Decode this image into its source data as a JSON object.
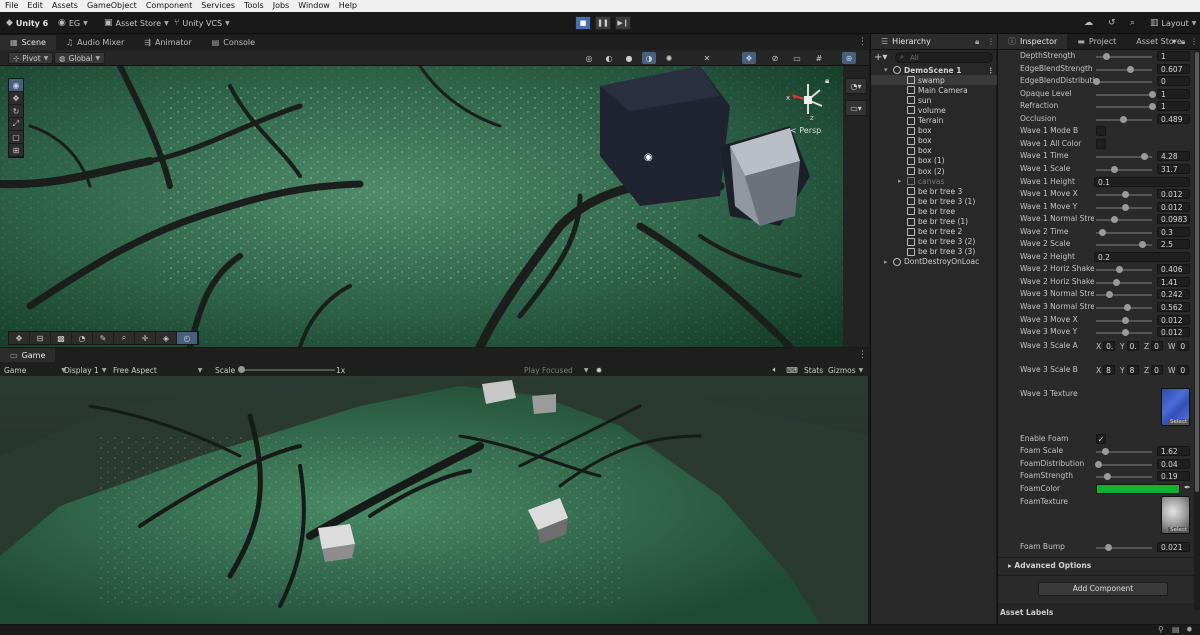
{
  "menubar": {
    "items": [
      "File",
      "Edit",
      "Assets",
      "GameObject",
      "Component",
      "Services",
      "Tools",
      "Jobs",
      "Window",
      "Help"
    ]
  },
  "toolbar": {
    "unity_label": "Unity 6",
    "account_label": "EG",
    "asset_store_label": "Asset Store",
    "vcs_label": "Unity VCS",
    "layout_label": "Layout"
  },
  "scene_tabs": [
    "Scene",
    "Audio Mixer",
    "Animator",
    "Console"
  ],
  "scene_toolbar": {
    "pivot": "Pivot",
    "global": "Global"
  },
  "scene_view": {
    "persp_label": "< Persp",
    "gizmo_x": "x",
    "gizmo_z": "z"
  },
  "game_tab": {
    "label": "Game"
  },
  "game_toolbar": {
    "display_mode": "Game",
    "display": "Display 1",
    "aspect": "Free Aspect",
    "scale_label": "Scale",
    "scale_value": "1x",
    "play_focused": "Play Focused",
    "stats": "Stats",
    "gizmos": "Gizmos"
  },
  "hierarchy": {
    "title": "Hierarchy",
    "search_placeholder": "All",
    "items": [
      {
        "label": "DemoScene 1",
        "style": "bold"
      },
      {
        "label": "swamp",
        "style": "sel"
      },
      {
        "label": "Main Camera",
        "style": ""
      },
      {
        "label": "sun",
        "style": ""
      },
      {
        "label": "volume",
        "style": ""
      },
      {
        "label": "Terrain",
        "style": ""
      },
      {
        "label": "box",
        "style": ""
      },
      {
        "label": "box",
        "style": ""
      },
      {
        "label": "box",
        "style": ""
      },
      {
        "label": "box (1)",
        "style": ""
      },
      {
        "label": "box (2)",
        "style": ""
      },
      {
        "label": "canvas",
        "style": "dim"
      },
      {
        "label": "be br tree 3",
        "style": ""
      },
      {
        "label": "be br tree 3 (1)",
        "style": ""
      },
      {
        "label": "be br tree",
        "style": ""
      },
      {
        "label": "be br tree (1)",
        "style": ""
      },
      {
        "label": "be br tree 2",
        "style": ""
      },
      {
        "label": "be br tree 3 (2)",
        "style": ""
      },
      {
        "label": "be br tree 3 (3)",
        "style": ""
      },
      {
        "label": "DontDestroyOnLoac",
        "style": "root"
      }
    ]
  },
  "inspector": {
    "tabs": [
      "Inspector",
      "Project",
      "Asset Store"
    ],
    "properties": [
      {
        "label": "DepthStrength",
        "kind": "slider",
        "value": "1",
        "pos": 0.18
      },
      {
        "label": "EdgeBlendStrength",
        "kind": "slider",
        "value": "0.607",
        "pos": 0.6
      },
      {
        "label": "EdgeBlendDistributio",
        "kind": "slider",
        "value": "0",
        "pos": 0.0
      },
      {
        "label": "Opaque Level",
        "kind": "slider",
        "value": "1",
        "pos": 1.0
      },
      {
        "label": "Refraction",
        "kind": "slider",
        "value": "1",
        "pos": 1.0
      },
      {
        "label": "Occlusion",
        "kind": "slider",
        "value": "0.489",
        "pos": 0.49
      },
      {
        "label": "Wave 1 Mode B",
        "kind": "check",
        "value": ""
      },
      {
        "label": "Wave 1 All Color",
        "kind": "check",
        "value": ""
      },
      {
        "label": "Wave 1 Time",
        "kind": "slider",
        "value": "4.28",
        "pos": 0.86
      },
      {
        "label": "Wave 1 Scale",
        "kind": "slider",
        "value": "31.7",
        "pos": 0.32
      },
      {
        "label": "Wave 1 Height",
        "kind": "field",
        "value": "0.1"
      },
      {
        "label": "Wave 1 Move X",
        "kind": "slider",
        "value": "0.012",
        "pos": 0.51
      },
      {
        "label": "Wave 1 Move Y",
        "kind": "slider",
        "value": "0.012",
        "pos": 0.51
      },
      {
        "label": "Wave 1 Normal Streng",
        "kind": "slider",
        "value": "0.0983",
        "pos": 0.33
      },
      {
        "label": "Wave 2 Time",
        "kind": "slider",
        "value": "0.3",
        "pos": 0.1
      },
      {
        "label": "Wave 2 Scale",
        "kind": "slider",
        "value": "2.5",
        "pos": 0.83
      },
      {
        "label": "Wave 2 Height",
        "kind": "field",
        "value": "0.2"
      },
      {
        "label": "Wave 2 Horiz Shake",
        "kind": "slider",
        "value": "0.406",
        "pos": 0.41
      },
      {
        "label": "Wave 2 Horiz Shake",
        "kind": "slider",
        "value": "1.41",
        "pos": 0.35
      },
      {
        "label": "Wave 3 Normal Streng",
        "kind": "slider",
        "value": "0.242",
        "pos": 0.24
      },
      {
        "label": "Wave 3 Normal Streng",
        "kind": "slider",
        "value": "0.562",
        "pos": 0.56
      },
      {
        "label": "Wave 3 Move X",
        "kind": "slider",
        "value": "0.012",
        "pos": 0.51
      },
      {
        "label": "Wave 3 Move Y",
        "kind": "slider",
        "value": "0.012",
        "pos": 0.51
      }
    ],
    "wave3_scale_a": {
      "label": "Wave 3 Scale A",
      "x": "0.",
      "y": "0.",
      "z": "0",
      "w": "0"
    },
    "wave3_scale_b": {
      "label": "Wave 3 Scale B",
      "x": "8",
      "y": "8",
      "z": "0",
      "w": "0"
    },
    "wave3_texture": {
      "label": "Wave 3 Texture",
      "select": "Select"
    },
    "enable_foam": {
      "label": "Enable Foam",
      "checked": "✓"
    },
    "foam": [
      {
        "label": "Foam Scale",
        "value": "1.62",
        "pos": 0.16
      },
      {
        "label": "FoamDistribution",
        "value": "0.04",
        "pos": 0.04
      },
      {
        "label": "FoamStrength",
        "value": "0.19",
        "pos": 0.19
      }
    ],
    "foam_color": {
      "label": "FoamColor",
      "color": "#10b232"
    },
    "foam_texture": {
      "label": "FoamTexture",
      "select": "Select"
    },
    "foam_bump": {
      "label": "Foam Bump",
      "value": "0.021",
      "pos": 0.21
    },
    "advanced_label": "Advanced Options",
    "add_component": "Add Component",
    "asset_labels": "Asset Labels"
  },
  "colors": {
    "accent": "#46607f",
    "play_active": "#4a6fa8"
  }
}
